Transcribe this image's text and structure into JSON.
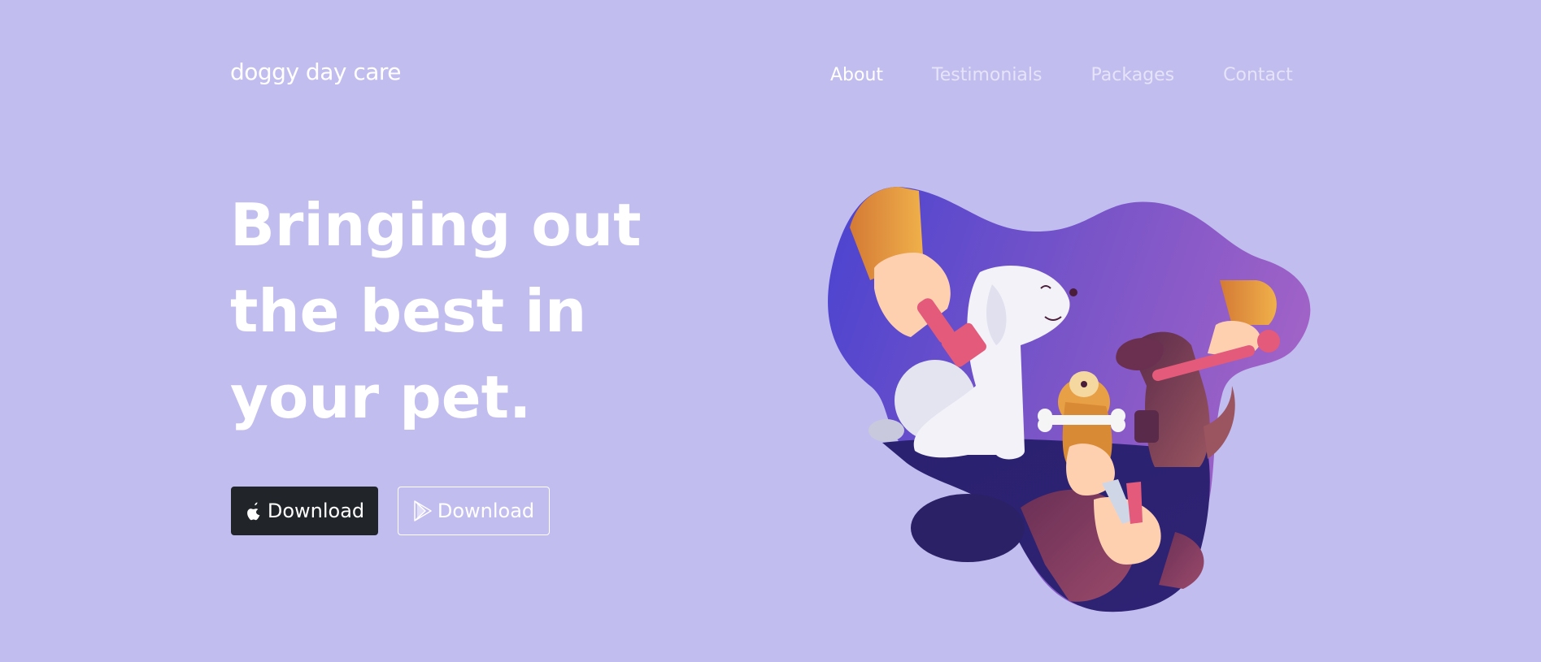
{
  "brand": "doggy day care",
  "nav": {
    "about": "About",
    "testimonials": "Testimonials",
    "packages": "Packages",
    "contact": "Contact"
  },
  "hero": {
    "title_lines": [
      "Bringing out",
      "the best in",
      "your pet."
    ]
  },
  "buttons": {
    "apple_label": "Download",
    "play_label": "Download"
  },
  "colors": {
    "background": "#c2bdef",
    "dark_button": "#212529",
    "accent_purple": "#5a45d1",
    "accent_pink": "#e85a7f"
  },
  "icons": {
    "apple": "apple-icon",
    "google_play": "google-play-icon"
  }
}
